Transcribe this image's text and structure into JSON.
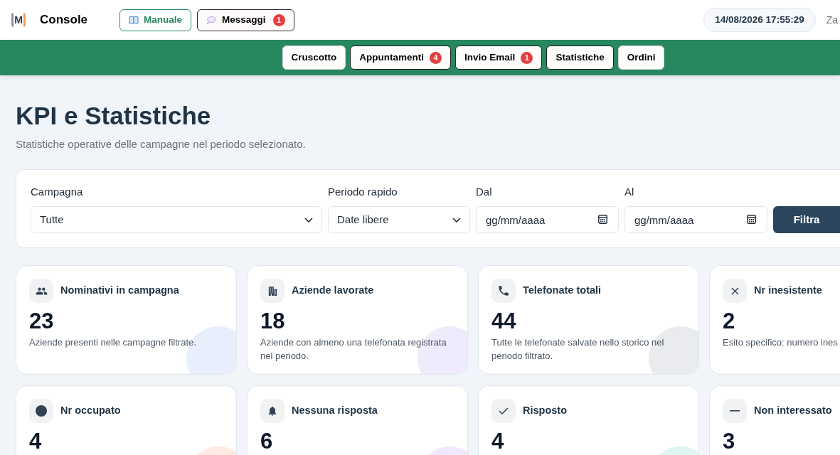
{
  "header": {
    "logo": "M",
    "title": "Console",
    "buttons": [
      {
        "kind": "manual",
        "label": "Manuale"
      },
      {
        "kind": "messages",
        "label": "Messaggi",
        "badge": "1"
      }
    ],
    "datetime": "14/08/2026 17:55:29",
    "user": "Za"
  },
  "nav": {
    "tabs": [
      {
        "label": "Cruscotto",
        "outlined": false
      },
      {
        "label": "Appuntamenti",
        "badge": "4",
        "outlined": true
      },
      {
        "label": "Invio Email",
        "badge": "1",
        "outlined": true
      },
      {
        "label": "Statistiche",
        "outlined": true
      },
      {
        "label": "Ordini",
        "outlined": false
      }
    ]
  },
  "page": {
    "title": "KPI e Statistiche",
    "subtitle": "Statistiche operative delle campagne nel periodo selezionato."
  },
  "filters": {
    "fields": [
      {
        "kind": "select",
        "label": "Campagna",
        "value": "Tutte"
      },
      {
        "kind": "select",
        "label": "Periodo rapido",
        "value": "Date libere"
      },
      {
        "kind": "date",
        "label": "Dal",
        "placeholder": "gg/mm/aaaa"
      },
      {
        "kind": "date",
        "label": "Al",
        "placeholder": "gg/mm/aaaa"
      }
    ],
    "button": "Filtra"
  },
  "kpis": [
    {
      "title": "Nominativi in campagna",
      "value": "23",
      "description": "Aziende presenti nelle campagne filtrate.",
      "color": "#e9eefc"
    },
    {
      "title": "Aziende lavorate",
      "value": "18",
      "description": "Aziende con almeno una telefonata registrata nel periodo.",
      "color": "#efeafc"
    },
    {
      "title": "Telefonate totali",
      "value": "44",
      "description": "Tutte le telefonate salvate nello storico nel periodo filtrato.",
      "color": "#eaebee"
    },
    {
      "title": "Nr inesistente",
      "value": "2",
      "description": "Esito specifico: numero ines"
    },
    {
      "title": "Nr occupato",
      "value": "4",
      "color": "#fdeae3"
    },
    {
      "title": "Nessuna risposta",
      "value": "6",
      "color": "#f0e8fc"
    },
    {
      "title": "Risposto",
      "value": "4",
      "color": "#e0f4f4"
    },
    {
      "title": "Non interessato",
      "value": "3"
    }
  ]
}
